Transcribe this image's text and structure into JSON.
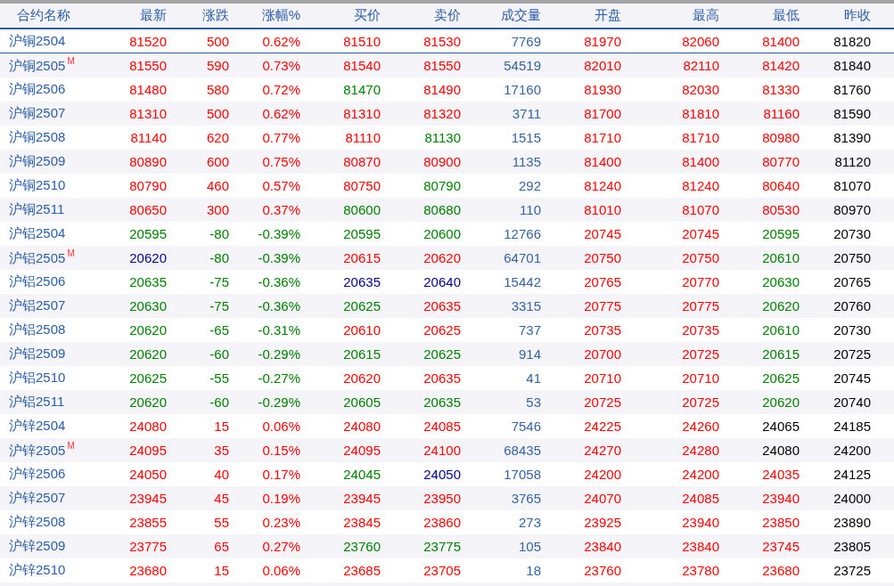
{
  "table": {
    "columns": [
      "合约名称",
      "最新",
      "涨跌",
      "涨幅%",
      "买价",
      "卖价",
      "成交量",
      "开盘",
      "最高",
      "最低",
      "昨收"
    ],
    "rows": [
      {
        "selected": true,
        "cells": [
          {
            "text": "沪铜2504"
          },
          {
            "text": "81520",
            "color": "#ff0000"
          },
          {
            "text": "500",
            "color": "#ff0000"
          },
          {
            "text": "0.62%",
            "color": "#ff0000"
          },
          {
            "text": "81510",
            "color": "#ff0000"
          },
          {
            "text": "81530",
            "color": "#ff0000"
          },
          {
            "text": "7769",
            "color": "#3563a6"
          },
          {
            "text": "81970",
            "color": "#ff0000"
          },
          {
            "text": "82060",
            "color": "#ff0000"
          },
          {
            "text": "81400",
            "color": "#ff0000"
          },
          {
            "text": "81820",
            "color": "#000000"
          }
        ]
      },
      {
        "selected": false,
        "cells": [
          {
            "text": "沪铜2505",
            "tag": "M"
          },
          {
            "text": "81550",
            "color": "#ff0000"
          },
          {
            "text": "590",
            "color": "#ff0000"
          },
          {
            "text": "0.73%",
            "color": "#ff0000"
          },
          {
            "text": "81540",
            "color": "#ff0000"
          },
          {
            "text": "81550",
            "color": "#ff0000"
          },
          {
            "text": "54519",
            "color": "#3563a6"
          },
          {
            "text": "82010",
            "color": "#ff0000"
          },
          {
            "text": "82110",
            "color": "#ff0000"
          },
          {
            "text": "81420",
            "color": "#ff0000"
          },
          {
            "text": "81840",
            "color": "#000000"
          }
        ]
      },
      {
        "selected": false,
        "cells": [
          {
            "text": "沪铜2506"
          },
          {
            "text": "81480",
            "color": "#ff0000"
          },
          {
            "text": "580",
            "color": "#ff0000"
          },
          {
            "text": "0.72%",
            "color": "#ff0000"
          },
          {
            "text": "81470",
            "color": "#008000"
          },
          {
            "text": "81490",
            "color": "#ff0000"
          },
          {
            "text": "17160",
            "color": "#3563a6"
          },
          {
            "text": "81930",
            "color": "#ff0000"
          },
          {
            "text": "82030",
            "color": "#ff0000"
          },
          {
            "text": "81330",
            "color": "#ff0000"
          },
          {
            "text": "81760",
            "color": "#000000"
          }
        ]
      },
      {
        "selected": false,
        "cells": [
          {
            "text": "沪铜2507"
          },
          {
            "text": "81310",
            "color": "#ff0000"
          },
          {
            "text": "500",
            "color": "#ff0000"
          },
          {
            "text": "0.62%",
            "color": "#ff0000"
          },
          {
            "text": "81310",
            "color": "#ff0000"
          },
          {
            "text": "81320",
            "color": "#ff0000"
          },
          {
            "text": "3711",
            "color": "#3563a6"
          },
          {
            "text": "81700",
            "color": "#ff0000"
          },
          {
            "text": "81810",
            "color": "#ff0000"
          },
          {
            "text": "81160",
            "color": "#ff0000"
          },
          {
            "text": "81590",
            "color": "#000000"
          }
        ]
      },
      {
        "selected": false,
        "cells": [
          {
            "text": "沪铜2508"
          },
          {
            "text": "81140",
            "color": "#ff0000"
          },
          {
            "text": "620",
            "color": "#ff0000"
          },
          {
            "text": "0.77%",
            "color": "#ff0000"
          },
          {
            "text": "81110",
            "color": "#ff0000"
          },
          {
            "text": "81130",
            "color": "#008000"
          },
          {
            "text": "1515",
            "color": "#3563a6"
          },
          {
            "text": "81710",
            "color": "#ff0000"
          },
          {
            "text": "81710",
            "color": "#ff0000"
          },
          {
            "text": "80980",
            "color": "#ff0000"
          },
          {
            "text": "81390",
            "color": "#000000"
          }
        ]
      },
      {
        "selected": false,
        "cells": [
          {
            "text": "沪铜2509"
          },
          {
            "text": "80890",
            "color": "#ff0000"
          },
          {
            "text": "600",
            "color": "#ff0000"
          },
          {
            "text": "0.75%",
            "color": "#ff0000"
          },
          {
            "text": "80870",
            "color": "#ff0000"
          },
          {
            "text": "80900",
            "color": "#ff0000"
          },
          {
            "text": "1135",
            "color": "#3563a6"
          },
          {
            "text": "81400",
            "color": "#ff0000"
          },
          {
            "text": "81400",
            "color": "#ff0000"
          },
          {
            "text": "80770",
            "color": "#ff0000"
          },
          {
            "text": "81120",
            "color": "#000000"
          }
        ]
      },
      {
        "selected": false,
        "cells": [
          {
            "text": "沪铜2510"
          },
          {
            "text": "80790",
            "color": "#ff0000"
          },
          {
            "text": "460",
            "color": "#ff0000"
          },
          {
            "text": "0.57%",
            "color": "#ff0000"
          },
          {
            "text": "80750",
            "color": "#ff0000"
          },
          {
            "text": "80790",
            "color": "#008000"
          },
          {
            "text": "292",
            "color": "#3563a6"
          },
          {
            "text": "81240",
            "color": "#ff0000"
          },
          {
            "text": "81240",
            "color": "#ff0000"
          },
          {
            "text": "80640",
            "color": "#ff0000"
          },
          {
            "text": "81070",
            "color": "#000000"
          }
        ]
      },
      {
        "selected": false,
        "cells": [
          {
            "text": "沪铜2511"
          },
          {
            "text": "80650",
            "color": "#ff0000"
          },
          {
            "text": "300",
            "color": "#ff0000"
          },
          {
            "text": "0.37%",
            "color": "#ff0000"
          },
          {
            "text": "80600",
            "color": "#008000"
          },
          {
            "text": "80680",
            "color": "#008000"
          },
          {
            "text": "110",
            "color": "#3563a6"
          },
          {
            "text": "81010",
            "color": "#ff0000"
          },
          {
            "text": "81070",
            "color": "#ff0000"
          },
          {
            "text": "80530",
            "color": "#ff0000"
          },
          {
            "text": "80970",
            "color": "#000000"
          }
        ]
      },
      {
        "selected": false,
        "cells": [
          {
            "text": "沪铝2504"
          },
          {
            "text": "20595",
            "color": "#008000"
          },
          {
            "text": "-80",
            "color": "#008000"
          },
          {
            "text": "-0.39%",
            "color": "#008000"
          },
          {
            "text": "20595",
            "color": "#008000"
          },
          {
            "text": "20600",
            "color": "#008000"
          },
          {
            "text": "12766",
            "color": "#3563a6"
          },
          {
            "text": "20745",
            "color": "#ff0000"
          },
          {
            "text": "20745",
            "color": "#ff0000"
          },
          {
            "text": "20595",
            "color": "#008000"
          },
          {
            "text": "20730",
            "color": "#000000"
          }
        ]
      },
      {
        "selected": false,
        "cells": [
          {
            "text": "沪铝2505",
            "tag": "M"
          },
          {
            "text": "20620",
            "color": "#000090"
          },
          {
            "text": "-80",
            "color": "#008000"
          },
          {
            "text": "-0.39%",
            "color": "#008000"
          },
          {
            "text": "20615",
            "color": "#ff0000"
          },
          {
            "text": "20620",
            "color": "#ff0000"
          },
          {
            "text": "64701",
            "color": "#3563a6"
          },
          {
            "text": "20750",
            "color": "#ff0000"
          },
          {
            "text": "20750",
            "color": "#ff0000"
          },
          {
            "text": "20610",
            "color": "#008000"
          },
          {
            "text": "20750",
            "color": "#000000"
          }
        ]
      },
      {
        "selected": false,
        "cells": [
          {
            "text": "沪铝2506"
          },
          {
            "text": "20635",
            "color": "#008000"
          },
          {
            "text": "-75",
            "color": "#008000"
          },
          {
            "text": "-0.36%",
            "color": "#008000"
          },
          {
            "text": "20635",
            "color": "#000090"
          },
          {
            "text": "20640",
            "color": "#000090"
          },
          {
            "text": "15442",
            "color": "#3563a6"
          },
          {
            "text": "20765",
            "color": "#ff0000"
          },
          {
            "text": "20770",
            "color": "#ff0000"
          },
          {
            "text": "20630",
            "color": "#008000"
          },
          {
            "text": "20765",
            "color": "#000000"
          }
        ]
      },
      {
        "selected": false,
        "cells": [
          {
            "text": "沪铝2507"
          },
          {
            "text": "20630",
            "color": "#008000"
          },
          {
            "text": "-75",
            "color": "#008000"
          },
          {
            "text": "-0.36%",
            "color": "#008000"
          },
          {
            "text": "20625",
            "color": "#008000"
          },
          {
            "text": "20635",
            "color": "#ff0000"
          },
          {
            "text": "3315",
            "color": "#3563a6"
          },
          {
            "text": "20775",
            "color": "#ff0000"
          },
          {
            "text": "20775",
            "color": "#ff0000"
          },
          {
            "text": "20620",
            "color": "#008000"
          },
          {
            "text": "20760",
            "color": "#000000"
          }
        ]
      },
      {
        "selected": false,
        "cells": [
          {
            "text": "沪铝2508"
          },
          {
            "text": "20620",
            "color": "#008000"
          },
          {
            "text": "-65",
            "color": "#008000"
          },
          {
            "text": "-0.31%",
            "color": "#008000"
          },
          {
            "text": "20610",
            "color": "#ff0000"
          },
          {
            "text": "20625",
            "color": "#ff0000"
          },
          {
            "text": "737",
            "color": "#3563a6"
          },
          {
            "text": "20735",
            "color": "#ff0000"
          },
          {
            "text": "20735",
            "color": "#ff0000"
          },
          {
            "text": "20610",
            "color": "#008000"
          },
          {
            "text": "20730",
            "color": "#000000"
          }
        ]
      },
      {
        "selected": false,
        "cells": [
          {
            "text": "沪铝2509"
          },
          {
            "text": "20620",
            "color": "#008000"
          },
          {
            "text": "-60",
            "color": "#008000"
          },
          {
            "text": "-0.29%",
            "color": "#008000"
          },
          {
            "text": "20615",
            "color": "#008000"
          },
          {
            "text": "20625",
            "color": "#008000"
          },
          {
            "text": "914",
            "color": "#3563a6"
          },
          {
            "text": "20700",
            "color": "#ff0000"
          },
          {
            "text": "20725",
            "color": "#ff0000"
          },
          {
            "text": "20615",
            "color": "#008000"
          },
          {
            "text": "20725",
            "color": "#000000"
          }
        ]
      },
      {
        "selected": false,
        "cells": [
          {
            "text": "沪铝2510"
          },
          {
            "text": "20625",
            "color": "#008000"
          },
          {
            "text": "-55",
            "color": "#008000"
          },
          {
            "text": "-0.27%",
            "color": "#008000"
          },
          {
            "text": "20620",
            "color": "#ff0000"
          },
          {
            "text": "20635",
            "color": "#ff0000"
          },
          {
            "text": "41",
            "color": "#3563a6"
          },
          {
            "text": "20710",
            "color": "#ff0000"
          },
          {
            "text": "20710",
            "color": "#ff0000"
          },
          {
            "text": "20625",
            "color": "#008000"
          },
          {
            "text": "20745",
            "color": "#000000"
          }
        ]
      },
      {
        "selected": false,
        "cells": [
          {
            "text": "沪铝2511"
          },
          {
            "text": "20620",
            "color": "#008000"
          },
          {
            "text": "-60",
            "color": "#008000"
          },
          {
            "text": "-0.29%",
            "color": "#008000"
          },
          {
            "text": "20605",
            "color": "#008000"
          },
          {
            "text": "20635",
            "color": "#008000"
          },
          {
            "text": "53",
            "color": "#3563a6"
          },
          {
            "text": "20725",
            "color": "#ff0000"
          },
          {
            "text": "20725",
            "color": "#ff0000"
          },
          {
            "text": "20620",
            "color": "#008000"
          },
          {
            "text": "20740",
            "color": "#000000"
          }
        ]
      },
      {
        "selected": false,
        "cells": [
          {
            "text": "沪锌2504"
          },
          {
            "text": "24080",
            "color": "#ff0000"
          },
          {
            "text": "15",
            "color": "#ff0000"
          },
          {
            "text": "0.06%",
            "color": "#ff0000"
          },
          {
            "text": "24080",
            "color": "#ff0000"
          },
          {
            "text": "24085",
            "color": "#ff0000"
          },
          {
            "text": "7546",
            "color": "#3563a6"
          },
          {
            "text": "24225",
            "color": "#ff0000"
          },
          {
            "text": "24260",
            "color": "#ff0000"
          },
          {
            "text": "24065",
            "color": "#000000"
          },
          {
            "text": "24185",
            "color": "#000000"
          }
        ]
      },
      {
        "selected": false,
        "cells": [
          {
            "text": "沪锌2505",
            "tag": "M"
          },
          {
            "text": "24095",
            "color": "#ff0000"
          },
          {
            "text": "35",
            "color": "#ff0000"
          },
          {
            "text": "0.15%",
            "color": "#ff0000"
          },
          {
            "text": "24095",
            "color": "#ff0000"
          },
          {
            "text": "24100",
            "color": "#ff0000"
          },
          {
            "text": "68435",
            "color": "#3563a6"
          },
          {
            "text": "24270",
            "color": "#ff0000"
          },
          {
            "text": "24280",
            "color": "#ff0000"
          },
          {
            "text": "24080",
            "color": "#000000"
          },
          {
            "text": "24200",
            "color": "#000000"
          }
        ]
      },
      {
        "selected": false,
        "cells": [
          {
            "text": "沪锌2506"
          },
          {
            "text": "24050",
            "color": "#ff0000"
          },
          {
            "text": "40",
            "color": "#ff0000"
          },
          {
            "text": "0.17%",
            "color": "#ff0000"
          },
          {
            "text": "24045",
            "color": "#008000"
          },
          {
            "text": "24050",
            "color": "#000090"
          },
          {
            "text": "17058",
            "color": "#3563a6"
          },
          {
            "text": "24200",
            "color": "#ff0000"
          },
          {
            "text": "24200",
            "color": "#ff0000"
          },
          {
            "text": "24035",
            "color": "#ff0000"
          },
          {
            "text": "24125",
            "color": "#000000"
          }
        ]
      },
      {
        "selected": false,
        "cells": [
          {
            "text": "沪锌2507"
          },
          {
            "text": "23945",
            "color": "#ff0000"
          },
          {
            "text": "45",
            "color": "#ff0000"
          },
          {
            "text": "0.19%",
            "color": "#ff0000"
          },
          {
            "text": "23945",
            "color": "#ff0000"
          },
          {
            "text": "23950",
            "color": "#ff0000"
          },
          {
            "text": "3765",
            "color": "#3563a6"
          },
          {
            "text": "24070",
            "color": "#ff0000"
          },
          {
            "text": "24085",
            "color": "#ff0000"
          },
          {
            "text": "23940",
            "color": "#ff0000"
          },
          {
            "text": "24000",
            "color": "#000000"
          }
        ]
      },
      {
        "selected": false,
        "cells": [
          {
            "text": "沪锌2508"
          },
          {
            "text": "23855",
            "color": "#ff0000"
          },
          {
            "text": "55",
            "color": "#ff0000"
          },
          {
            "text": "0.23%",
            "color": "#ff0000"
          },
          {
            "text": "23845",
            "color": "#ff0000"
          },
          {
            "text": "23860",
            "color": "#ff0000"
          },
          {
            "text": "273",
            "color": "#3563a6"
          },
          {
            "text": "23925",
            "color": "#ff0000"
          },
          {
            "text": "23940",
            "color": "#ff0000"
          },
          {
            "text": "23850",
            "color": "#ff0000"
          },
          {
            "text": "23890",
            "color": "#000000"
          }
        ]
      },
      {
        "selected": false,
        "cells": [
          {
            "text": "沪锌2509"
          },
          {
            "text": "23775",
            "color": "#ff0000"
          },
          {
            "text": "65",
            "color": "#ff0000"
          },
          {
            "text": "0.27%",
            "color": "#ff0000"
          },
          {
            "text": "23760",
            "color": "#008000"
          },
          {
            "text": "23775",
            "color": "#008000"
          },
          {
            "text": "105",
            "color": "#3563a6"
          },
          {
            "text": "23840",
            "color": "#ff0000"
          },
          {
            "text": "23840",
            "color": "#ff0000"
          },
          {
            "text": "23745",
            "color": "#ff0000"
          },
          {
            "text": "23805",
            "color": "#000000"
          }
        ]
      },
      {
        "selected": false,
        "cells": [
          {
            "text": "沪锌2510"
          },
          {
            "text": "23680",
            "color": "#ff0000"
          },
          {
            "text": "15",
            "color": "#ff0000"
          },
          {
            "text": "0.06%",
            "color": "#ff0000"
          },
          {
            "text": "23685",
            "color": "#ff0000"
          },
          {
            "text": "23705",
            "color": "#ff0000"
          },
          {
            "text": "18",
            "color": "#3563a6"
          },
          {
            "text": "23760",
            "color": "#ff0000"
          },
          {
            "text": "23780",
            "color": "#ff0000"
          },
          {
            "text": "23680",
            "color": "#ff0000"
          },
          {
            "text": "23725",
            "color": "#000000"
          }
        ]
      }
    ]
  }
}
